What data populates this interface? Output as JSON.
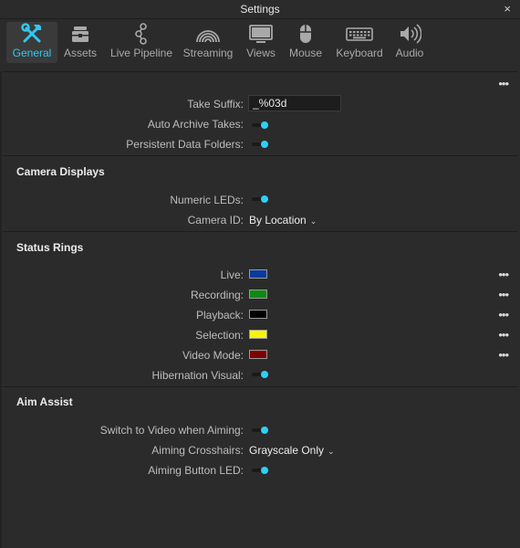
{
  "window": {
    "title": "Settings",
    "close_glyph": "×"
  },
  "tabs": [
    {
      "label": "General",
      "icon": "tools-icon",
      "active": true
    },
    {
      "label": "Assets",
      "icon": "toolbox-icon",
      "active": false
    },
    {
      "label": "Live Pipeline",
      "icon": "pipeline-icon",
      "active": false
    },
    {
      "label": "Streaming",
      "icon": "broadcast-icon",
      "active": false
    },
    {
      "label": "Views",
      "icon": "monitor-icon",
      "active": false
    },
    {
      "label": "Mouse",
      "icon": "mouse-icon",
      "active": false
    },
    {
      "label": "Keyboard",
      "icon": "keyboard-icon",
      "active": false
    },
    {
      "label": "Audio",
      "icon": "speaker-icon",
      "active": false
    }
  ],
  "general": {
    "take_suffix_label": "Take Suffix:",
    "take_suffix_value": "_%03d",
    "auto_archive_label": "Auto Archive Takes:",
    "auto_archive_on": true,
    "persistent_folders_label": "Persistent Data Folders:",
    "persistent_folders_on": true
  },
  "camera_displays": {
    "title": "Camera Displays",
    "numeric_leds_label": "Numeric LEDs:",
    "numeric_leds_on": true,
    "camera_id_label": "Camera ID:",
    "camera_id_value": "By Location"
  },
  "status_rings": {
    "title": "Status Rings",
    "items": [
      {
        "label": "Live:",
        "color": "#0a3a9e"
      },
      {
        "label": "Recording:",
        "color": "#0e8a12"
      },
      {
        "label": "Playback:",
        "color": "#000000"
      },
      {
        "label": "Selection:",
        "color": "#f7f40a"
      },
      {
        "label": "Video Mode:",
        "color": "#7d0000"
      }
    ],
    "hibernation_label": "Hibernation Visual:",
    "hibernation_on": true
  },
  "aim_assist": {
    "title": "Aim Assist",
    "switch_video_label": "Switch to Video when Aiming:",
    "switch_video_on": true,
    "crosshairs_label": "Aiming Crosshairs:",
    "crosshairs_value": "Grayscale Only",
    "button_led_label": "Aiming Button LED:",
    "button_led_on": true
  },
  "colors": {
    "accent": "#2fc8f3",
    "background": "#2b2b2b"
  }
}
